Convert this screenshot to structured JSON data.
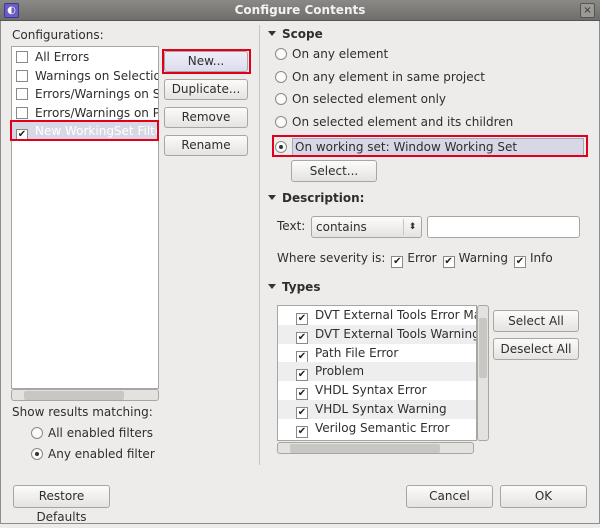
{
  "window": {
    "title": "Configure Contents",
    "icon": "eclipse-icon",
    "close": "×"
  },
  "configurations": {
    "label": "Configurations:",
    "items": [
      {
        "label": "All Errors",
        "checked": false
      },
      {
        "label": "Warnings on Selection",
        "checked": false
      },
      {
        "label": "Errors/Warnings on Sele",
        "checked": false
      },
      {
        "label": "Errors/Warnings on Proje",
        "checked": false
      },
      {
        "label": "New WorkingSet Filter",
        "checked": true,
        "selected": true
      }
    ]
  },
  "buttons": {
    "new": "New...",
    "duplicate": "Duplicate...",
    "remove": "Remove",
    "rename": "Rename",
    "select": "Select...",
    "select_all": "Select All",
    "deselect_all": "Deselect All",
    "restore": "Restore Defaults",
    "cancel": "Cancel",
    "ok": "OK"
  },
  "scope": {
    "title": "Scope",
    "options": [
      "On any element",
      "On any element in same project",
      "On selected element only",
      "On selected element and its children",
      "On working set:  Window Working Set"
    ],
    "selected": 4
  },
  "description": {
    "title": "Description:",
    "text_label": "Text:",
    "combo_value": "contains",
    "text_value": "",
    "severity_label": "Where severity is:",
    "severity": [
      {
        "label": "Error",
        "checked": true
      },
      {
        "label": "Warning",
        "checked": true
      },
      {
        "label": "Info",
        "checked": true
      }
    ]
  },
  "types": {
    "title": "Types",
    "items": [
      "DVT External Tools Error Mark",
      "DVT External Tools Warning M",
      "Path File Error",
      "Problem",
      "VHDL Syntax Error",
      "VHDL Syntax Warning",
      "Verilog Semantic Error"
    ]
  },
  "matching": {
    "label": "Show results matching:",
    "options": [
      "All enabled filters",
      "Any enabled filter"
    ],
    "selected": 1
  },
  "colors": {
    "highlight": "#e0001b",
    "selection": "#d8d7e6"
  }
}
